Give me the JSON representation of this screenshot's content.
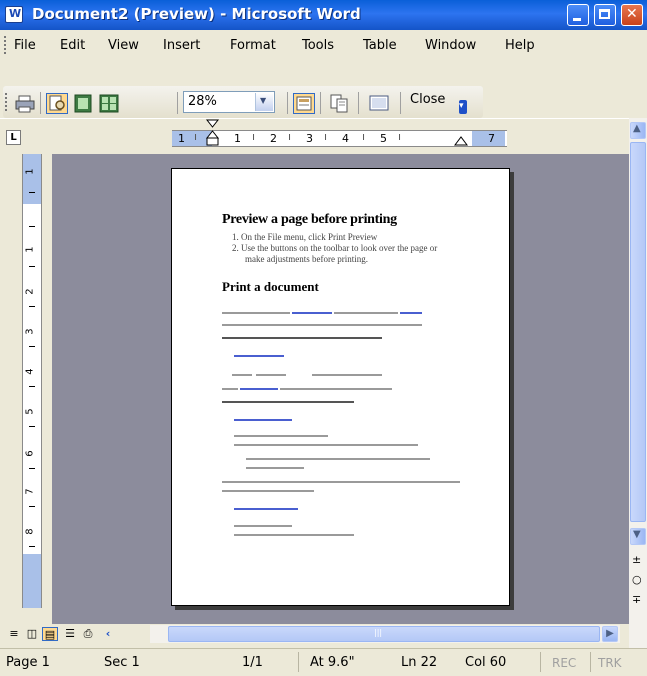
{
  "window": {
    "title": "Document2 (Preview) - Microsoft Word"
  },
  "menu": [
    "File",
    "Edit",
    "View",
    "Insert",
    "Format",
    "Tools",
    "Table",
    "Window",
    "Help"
  ],
  "toolbar": {
    "zoom": "28%",
    "close_label": "Close"
  },
  "rulers": {
    "horizontal": [
      "1",
      "1",
      "2",
      "3",
      "4",
      "5",
      "7"
    ],
    "vertical": [
      "1",
      "1",
      "2",
      "3",
      "4",
      "5",
      "6",
      "7",
      "8"
    ]
  },
  "document": {
    "heading1": "Preview a page before printing",
    "steps": [
      "1. On the File menu, click Print Preview",
      "2. Use the buttons on the toolbar to look over the page or",
      "make adjustments before printing."
    ],
    "heading2": "Print a document"
  },
  "status": {
    "page": "Page 1",
    "section": "Sec 1",
    "pages": "1/1",
    "at": "At 9.6\"",
    "line": "Ln 22",
    "col": "Col 60",
    "rec": "REC",
    "trk": "TRK"
  }
}
